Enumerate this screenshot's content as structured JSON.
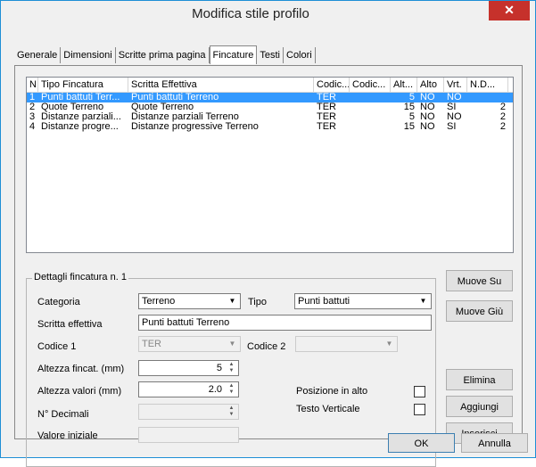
{
  "window": {
    "title": "Modifica stile profilo",
    "close_glyph": "✕"
  },
  "tabs": [
    "Generale",
    "Dimensioni",
    "Scritte prima pagina",
    "Fincature",
    "Testi",
    "Colori"
  ],
  "list": {
    "columns": [
      "N.",
      "Tipo Fincatura",
      "Scritta Effettiva",
      "Codic...",
      "Codic...",
      "Alt...",
      "Alto",
      "Vrt.",
      "N.D..."
    ],
    "rows": [
      {
        "n": "1",
        "tipo": "Punti battuti Terr...",
        "scritta": "Punti battuti Terreno",
        "cod1": "TER",
        "cod2": "",
        "alt": "5",
        "alto": "NO",
        "vrt": "NO",
        "nd": ""
      },
      {
        "n": "2",
        "tipo": "Quote Terreno",
        "scritta": "Quote Terreno",
        "cod1": "TER",
        "cod2": "",
        "alt": "15",
        "alto": "NO",
        "vrt": "SI",
        "nd": "2"
      },
      {
        "n": "3",
        "tipo": "Distanze parziali...",
        "scritta": "Distanze parziali Terreno",
        "cod1": "TER",
        "cod2": "",
        "alt": "5",
        "alto": "NO",
        "vrt": "NO",
        "nd": "2"
      },
      {
        "n": "4",
        "tipo": "Distanze progre...",
        "scritta": "Distanze progressive Terreno",
        "cod1": "TER",
        "cod2": "",
        "alt": "15",
        "alto": "NO",
        "vrt": "SI",
        "nd": "2"
      }
    ],
    "selected_index": 0
  },
  "details": {
    "group_label": "Dettagli fincatura n. 1",
    "categoria_label": "Categoria",
    "categoria_value": "Terreno",
    "tipo_label": "Tipo",
    "tipo_value": "Punti battuti",
    "scritta_label": "Scritta effettiva",
    "scritta_value": "Punti battuti Terreno",
    "codice1_label": "Codice 1",
    "codice1_value": "TER",
    "codice2_label": "Codice 2",
    "codice2_value": "",
    "altezza_fincat_label": "Altezza fincat. (mm)",
    "altezza_fincat_value": "5",
    "altezza_valori_label": "Altezza valori (mm)",
    "altezza_valori_value": "2.0",
    "decimali_label": "N° Decimali",
    "decimali_value": "",
    "valore_iniziale_label": "Valore iniziale",
    "valore_iniziale_value": "",
    "posizione_label": "Posizione in alto",
    "testo_verticale_label": "Testo Verticale"
  },
  "buttons": {
    "muove_su": "Muove Su",
    "muove_giu": "Muove Giù",
    "elimina": "Elimina",
    "aggiungi": "Aggiungi",
    "inserisci": "Inserisci",
    "ok": "OK",
    "annulla": "Annulla"
  },
  "colors": {
    "selection": "#3399ff",
    "close": "#c6312b"
  }
}
